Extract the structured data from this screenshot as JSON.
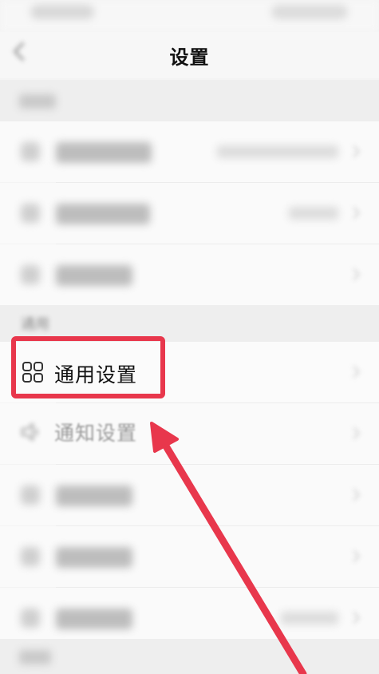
{
  "header": {
    "title": "设置"
  },
  "sections": {
    "general_header": "通用"
  },
  "rows": {
    "general_settings": {
      "label": "通用设置",
      "icon": "grid-icon"
    },
    "notification_settings": {
      "label": "通知设置",
      "icon": "speaker-icon"
    }
  },
  "icons": {
    "back": "back-arrow-icon",
    "chevron": "chevron-right-icon"
  },
  "colors": {
    "highlight": "#e8374c",
    "arrow": "#e8374c",
    "background": "#f4f4f4",
    "title": "#111111"
  }
}
